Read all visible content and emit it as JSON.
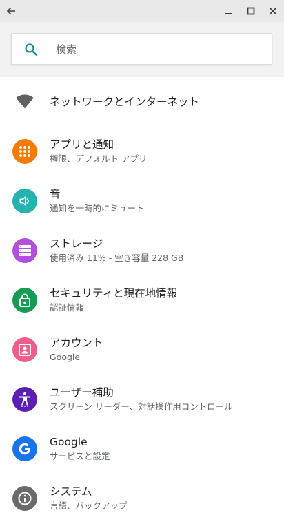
{
  "search": {
    "placeholder": "検索"
  },
  "items": [
    {
      "title": "ネットワークとインターネット",
      "subtitle": "",
      "icon": "wifi-icon",
      "color": "#616161"
    },
    {
      "title": "アプリと通知",
      "subtitle": "権限、デフォルト アプリ",
      "icon": "apps-grid-icon",
      "color": "#f57c00"
    },
    {
      "title": "音",
      "subtitle": "通知を一時的にミュート",
      "icon": "volume-icon",
      "color": "#26b3b0"
    },
    {
      "title": "ストレージ",
      "subtitle": "使用済み 11% - 空き容量 228 GB",
      "icon": "storage-icon",
      "color": "#b34ee0"
    },
    {
      "title": "セキュリティと現在地情報",
      "subtitle": "認証情報",
      "icon": "lock-icon",
      "color": "#169b55"
    },
    {
      "title": "アカウント",
      "subtitle": "Google",
      "icon": "account-box-icon",
      "color": "#ec5f8a"
    },
    {
      "title": "ユーザー補助",
      "subtitle": "スクリーン リーダー、対話操作用コントロール",
      "icon": "accessibility-icon",
      "color": "#5b1fb2"
    },
    {
      "title": "Google",
      "subtitle": "サービスと設定",
      "icon": "google-icon",
      "color": "#1a73e8"
    },
    {
      "title": "システム",
      "subtitle": "言語、バックアップ",
      "icon": "info-icon",
      "color": "#6b6b6b"
    }
  ]
}
